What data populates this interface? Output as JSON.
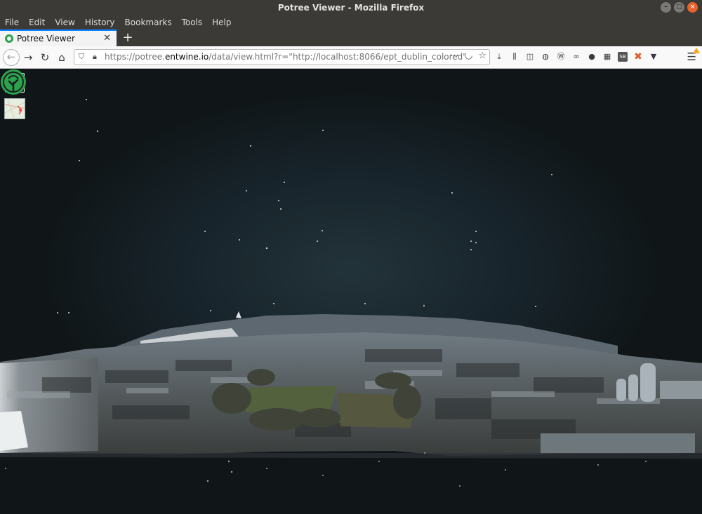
{
  "window": {
    "title": "Potree Viewer - Mozilla Firefox"
  },
  "menu": {
    "items": [
      "File",
      "Edit",
      "View",
      "History",
      "Bookmarks",
      "Tools",
      "Help"
    ]
  },
  "tabs": [
    {
      "label": "Potree Viewer",
      "icon": "potree-favicon",
      "active": true
    }
  ],
  "address_bar": {
    "url_prefix": "https://potree.",
    "url_domain": "entwine.io",
    "url_suffix": "/data/view.html?r=\"http://localhost:8066/ept_dublin_colored\""
  },
  "icons": {
    "nav": [
      "back-arrow-icon",
      "forward-arrow-icon",
      "reload-icon",
      "home-icon"
    ],
    "url_actions": [
      "page-actions-icon",
      "pocket-icon",
      "bookmark-star-icon"
    ],
    "toolbar": [
      "downloads-icon",
      "library-icon",
      "sidebar-icon",
      "extension-globe-icon",
      "extension-wordpress-icon",
      "extension-infinity-icon",
      "account-icon",
      "extension-grid-icon",
      "extension-sb-icon",
      "extension-x-icon",
      "extension-v-icon",
      "hamburger-menu-icon"
    ]
  },
  "viewer": {
    "scene": "dublin colored point cloud",
    "accent_color": "#2ca24d"
  }
}
